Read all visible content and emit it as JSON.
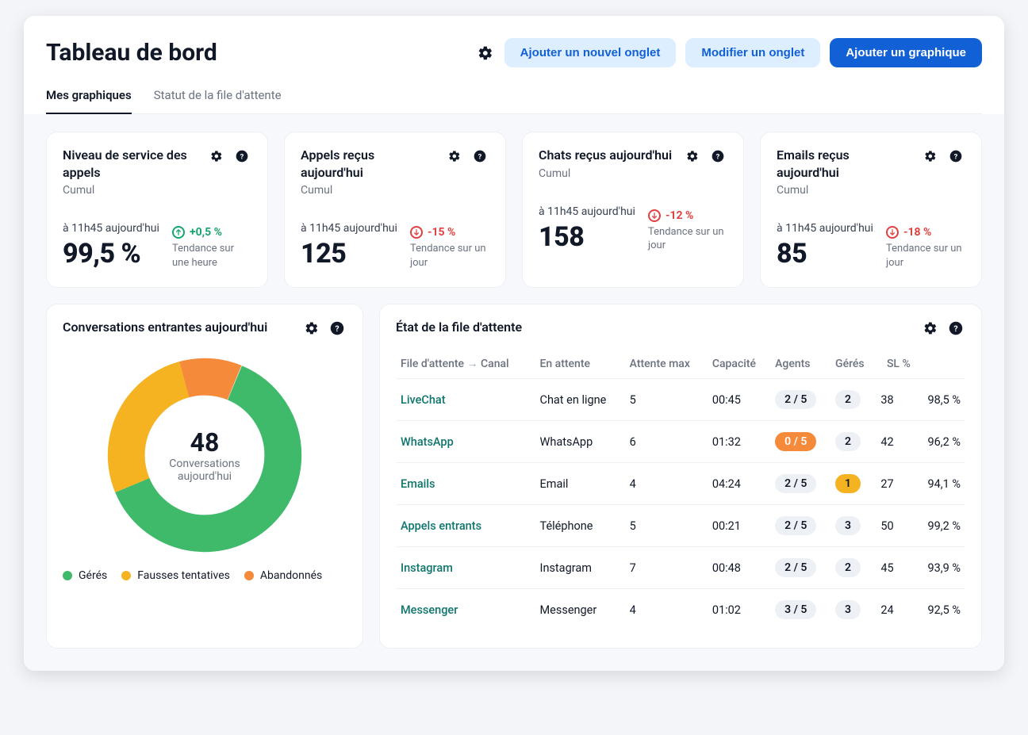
{
  "header": {
    "title": "Tableau de bord",
    "btn_add_tab": "Ajouter un nouvel onglet",
    "btn_edit_tab": "Modifier un onglet",
    "btn_add_chart": "Ajouter un graphique"
  },
  "tabs": {
    "active": "Mes graphiques",
    "inactive": "Statut de la file d'attente"
  },
  "kpi": [
    {
      "title": "Niveau de service des appels",
      "sub": "Cumul",
      "time": "à 11h45 aujourd'hui",
      "value": "99,5 %",
      "trend_dir": "up",
      "trend_val": "+0,5 %",
      "trend_label": "Tendance sur une heure"
    },
    {
      "title": "Appels reçus aujourd'hui",
      "sub": "Cumul",
      "time": "à 11h45 aujourd'hui",
      "value": "125",
      "trend_dir": "down",
      "trend_val": "-15 %",
      "trend_label": "Tendance sur un jour"
    },
    {
      "title": "Chats reçus aujourd'hui",
      "sub": "Cumul",
      "time": "à 11h45 aujourd'hui",
      "value": "158",
      "trend_dir": "down",
      "trend_val": "-12 %",
      "trend_label": "Tendance sur un jour"
    },
    {
      "title": "Emails reçus aujourd'hui",
      "sub": "Cumul",
      "time": "à 11h45 aujourd'hui",
      "value": "85",
      "trend_dir": "down",
      "trend_val": "-18 %",
      "trend_label": "Tendance sur un jour"
    }
  ],
  "donut": {
    "title": "Conversations entrantes aujourd'hui",
    "center_value": "48",
    "center_label_1": "Conversations",
    "center_label_2": "aujourd'hui",
    "legend": [
      {
        "label": "Gérés",
        "color": "#3fba6b"
      },
      {
        "label": "Fausses tentatives",
        "color": "#f5b321"
      },
      {
        "label": "Abandonnés",
        "color": "#f58a3b"
      }
    ]
  },
  "queue": {
    "title": "État de la file d'attente",
    "columns": {
      "c0": "File d'attente",
      "c0b": "Canal",
      "c1": "En attente",
      "c2": "Attente max",
      "c3": "Capacité",
      "c4": "Agents",
      "c5": "Gérés",
      "c6": "SL %"
    },
    "rows": [
      {
        "name": "LiveChat",
        "channel": "Chat en ligne",
        "waiting": "5",
        "maxwait": "00:45",
        "capacity": "2 / 5",
        "cap_style": "",
        "agents": "2",
        "ag_style": "",
        "handled": "38",
        "sl": "98,5 %"
      },
      {
        "name": "WhatsApp",
        "channel": "WhatsApp",
        "waiting": "6",
        "maxwait": "01:32",
        "capacity": "0 / 5",
        "cap_style": "warn",
        "agents": "2",
        "ag_style": "",
        "handled": "42",
        "sl": "96,2 %"
      },
      {
        "name": "Emails",
        "channel": "Email",
        "waiting": "4",
        "maxwait": "04:24",
        "capacity": "2 / 5",
        "cap_style": "",
        "agents": "1",
        "ag_style": "amber",
        "handled": "27",
        "sl": "94,1 %"
      },
      {
        "name": "Appels entrants",
        "channel": "Téléphone",
        "waiting": "5",
        "maxwait": "00:21",
        "capacity": "2 / 5",
        "cap_style": "",
        "agents": "3",
        "ag_style": "",
        "handled": "50",
        "sl": "99,2 %"
      },
      {
        "name": "Instagram",
        "channel": "Instagram",
        "waiting": "7",
        "maxwait": "00:48",
        "capacity": "2 / 5",
        "cap_style": "",
        "agents": "2",
        "ag_style": "",
        "handled": "45",
        "sl": "93,9 %"
      },
      {
        "name": "Messenger",
        "channel": "Messenger",
        "waiting": "4",
        "maxwait": "01:02",
        "capacity": "3 / 5",
        "cap_style": "",
        "agents": "3",
        "ag_style": "",
        "handled": "24",
        "sl": "92,5 %"
      }
    ]
  },
  "chart_data": {
    "type": "pie",
    "title": "Conversations entrantes aujourd'hui",
    "total": 48,
    "series": [
      {
        "name": "Gérés",
        "value": 30,
        "color": "#3fba6b"
      },
      {
        "name": "Fausses tentatives",
        "value": 13,
        "color": "#f5b321"
      },
      {
        "name": "Abandonnés",
        "value": 5,
        "color": "#f58a3b"
      }
    ]
  }
}
